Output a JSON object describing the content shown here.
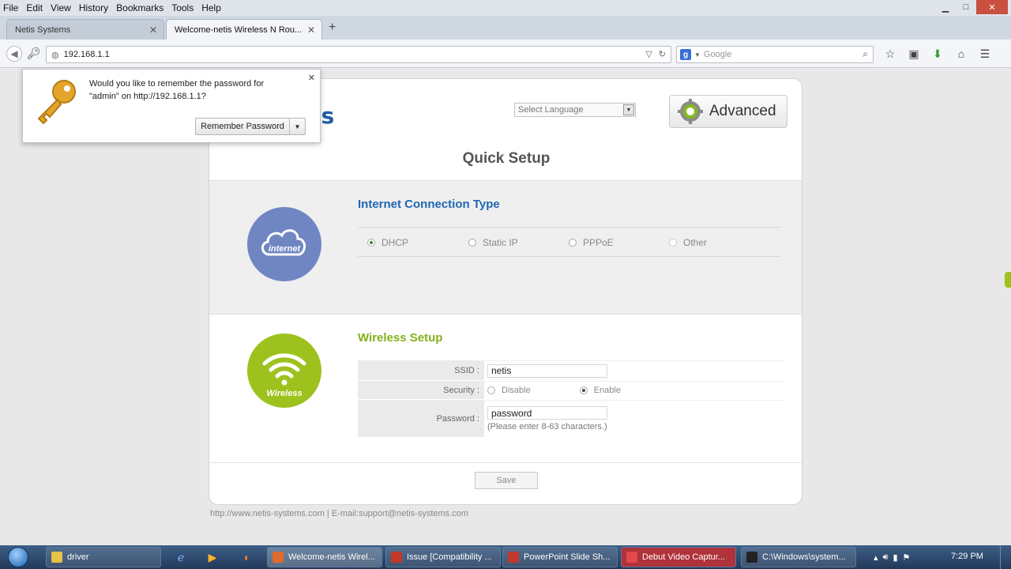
{
  "menubar": {
    "items": [
      "File",
      "Edit",
      "View",
      "History",
      "Bookmarks",
      "Tools",
      "Help"
    ]
  },
  "tabs": [
    {
      "label": "Netis Systems"
    },
    {
      "label": "Welcome-netis Wireless N Rou..."
    }
  ],
  "nav": {
    "url": "192.168.1.1",
    "search_placeholder": "Google"
  },
  "popup": {
    "message_line1": "Would you like to remember the password for",
    "message_line2": "\"admin\" on http://192.168.1.1?",
    "button_label": "Remember Password"
  },
  "header": {
    "logo_fragment": "is",
    "language_placeholder": "Select Language",
    "advanced_label": "Advanced"
  },
  "page_title": "Quick Setup",
  "internet": {
    "heading": "Internet Connection Type",
    "icon_label": "internet",
    "options": [
      "DHCP",
      "Static IP",
      "PPPoE",
      "Other"
    ],
    "selected": "DHCP"
  },
  "wireless": {
    "heading": "Wireless Setup",
    "icon_label": "Wireless",
    "ssid_label": "SSID :",
    "ssid_value": "netis",
    "security_label": "Security :",
    "security_options": [
      "Disable",
      "Enable"
    ],
    "security_selected": "Enable",
    "password_label": "Password :",
    "password_value": "password",
    "password_hint": "(Please enter 8-63 characters.)"
  },
  "save_label": "Save",
  "footer": "http://www.netis-systems.com | E-mail:support@netis-systems.com",
  "taskbar": {
    "items": [
      {
        "label": "driver",
        "color": "#e6c34a"
      },
      {
        "label": "Welcome-netis Wirel...",
        "color": "#e06a2a"
      },
      {
        "label": "Issue [Compatibility ...",
        "color": "#c0392b"
      },
      {
        "label": "PowerPoint Slide Sh...",
        "color": "#c0392b"
      },
      {
        "label": "Debut Video Captur...",
        "color": "#c0392b"
      },
      {
        "label": "C:\\Windows\\system...",
        "color": "#333333"
      }
    ],
    "clock": "7:29 PM"
  },
  "colors": {
    "internet_heading": "#1f66b3",
    "wireless_heading": "#83b11a",
    "internet_circle": "#7086c3",
    "wireless_circle": "#9ec21d"
  }
}
